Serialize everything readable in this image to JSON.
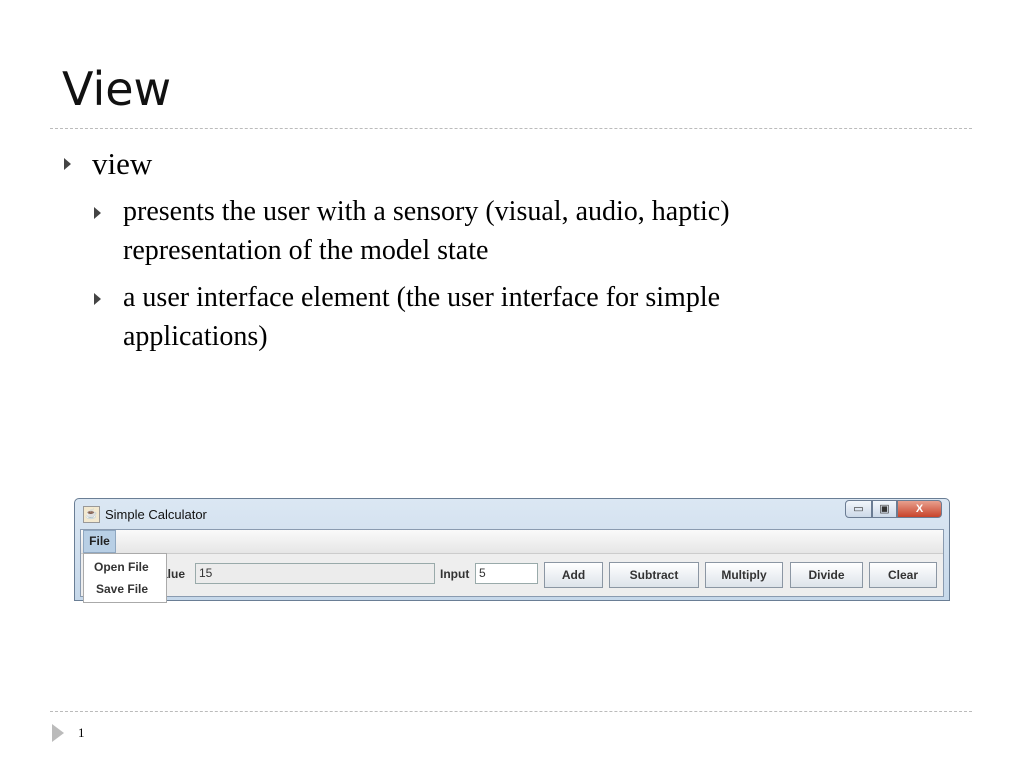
{
  "slide": {
    "title": "View",
    "page_number": "1",
    "bullets": [
      {
        "text": "view",
        "sub": [
          "presents the user with a sensory (visual, audio, haptic)",
          "representation of the model state",
          "a user interface element (the user interface for simple",
          "applications)"
        ]
      }
    ]
  },
  "window": {
    "title": "Simple Calculator",
    "controls": {
      "minimize": "▭",
      "maximize": "▣",
      "close": "X"
    },
    "menu": {
      "file": "File",
      "items": [
        "Open File",
        "Save File"
      ]
    },
    "value_label": "Value",
    "value_label_visible": "alue",
    "value": "15",
    "input_label": "Input",
    "input_value": "5",
    "buttons": [
      "Add",
      "Subtract",
      "Multiply",
      "Divide",
      "Clear"
    ]
  }
}
